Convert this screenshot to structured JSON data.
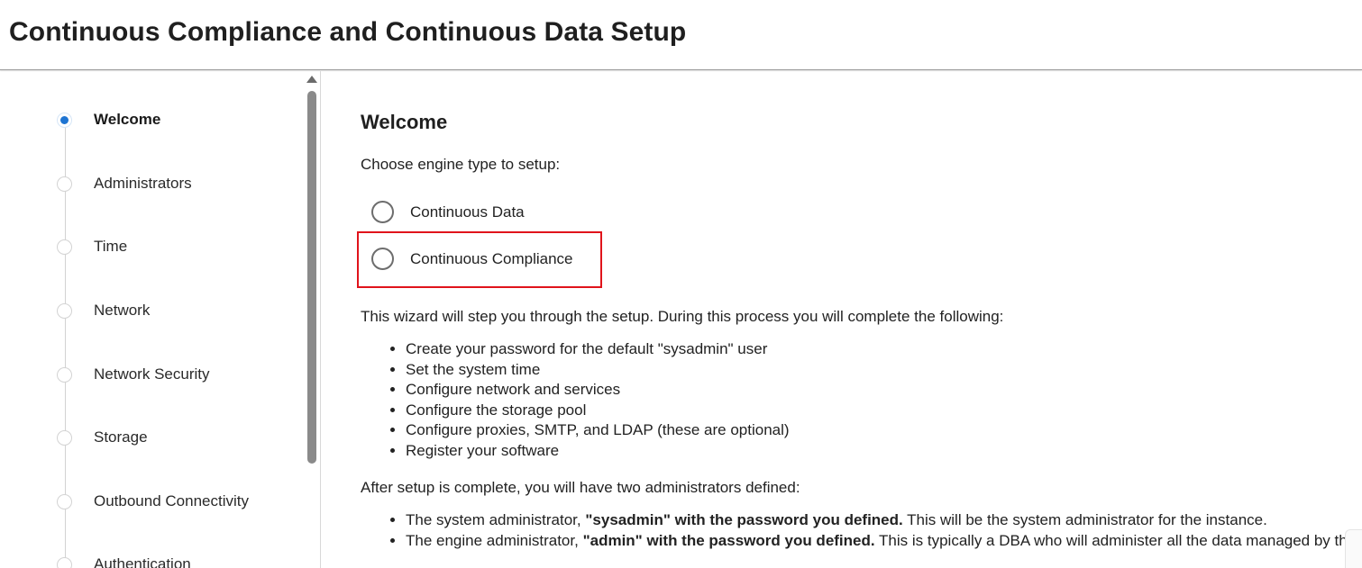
{
  "header": {
    "title": "Continuous Compliance and Continuous Data Setup"
  },
  "sidebar": {
    "steps": [
      {
        "label": "Welcome",
        "active": true
      },
      {
        "label": "Administrators",
        "active": false
      },
      {
        "label": "Time",
        "active": false
      },
      {
        "label": "Network",
        "active": false
      },
      {
        "label": "Network Security",
        "active": false
      },
      {
        "label": "Storage",
        "active": false
      },
      {
        "label": "Outbound Connectivity",
        "active": false
      },
      {
        "label": "Authentication",
        "active": false
      }
    ]
  },
  "main": {
    "heading": "Welcome",
    "choose_prompt": "Choose engine type to setup:",
    "engine_options": [
      {
        "label": "Continuous Data",
        "selected": false
      },
      {
        "label": "Continuous Compliance",
        "selected": false
      }
    ],
    "wizard_intro": "This wizard will step you through the setup. During this process you will complete the following:",
    "wizard_steps": [
      "Create your password for the default \"sysadmin\" user",
      "Set the system time",
      "Configure network and services",
      "Configure the storage pool",
      "Configure proxies, SMTP, and LDAP (these are optional)",
      "Register your software"
    ],
    "after_intro": "After setup is complete, you will have two administrators defined:",
    "admins": [
      {
        "prefix": "The system administrator, ",
        "bold": "\"sysadmin\" with the password you defined.",
        "suffix": " This will be the system administrator for the instance."
      },
      {
        "prefix": "The engine administrator, ",
        "bold": "\"admin\" with the password you defined.",
        "suffix": " This is typically a DBA who will administer all the data managed by the engine."
      }
    ]
  },
  "colors": {
    "active_step": "#1e74d2",
    "highlight_border": "#e0141b"
  }
}
